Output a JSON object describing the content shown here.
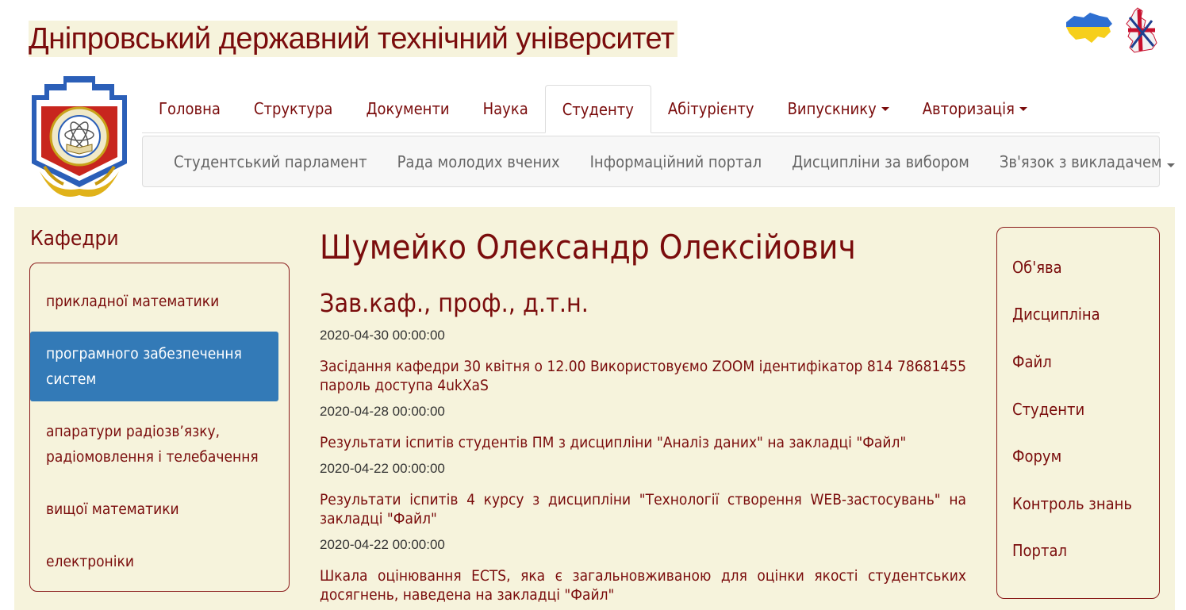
{
  "site": {
    "title": "Дніпровський державний технічний університет"
  },
  "languages": [
    {
      "icon": "ukraine-flag-icon"
    },
    {
      "icon": "uk-flag-icon"
    }
  ],
  "main_nav": [
    {
      "label": "Головна"
    },
    {
      "label": "Структура"
    },
    {
      "label": "Документи"
    },
    {
      "label": "Наука"
    },
    {
      "label": "Студенту",
      "active": true
    },
    {
      "label": "Абітурієнту"
    },
    {
      "label": "Випускнику",
      "dropdown": true
    },
    {
      "label": "Авторизація",
      "dropdown": true
    }
  ],
  "sub_nav": [
    {
      "label": "Студентський парламент"
    },
    {
      "label": "Рада молодих вчених"
    },
    {
      "label": "Інформаційний портал"
    },
    {
      "label": "Дисципліни за вибором"
    },
    {
      "label": "Зв'язок з викладачем",
      "dropdown": true
    }
  ],
  "departments": {
    "heading": "Кафедри",
    "items": [
      {
        "label": "прикладної математики"
      },
      {
        "label": "програмного забезпечення систем",
        "active": true
      },
      {
        "label": "апаратури радіозв’язку, радіомовлення і телебачення"
      },
      {
        "label": "вищої математики"
      },
      {
        "label": "електроніки"
      }
    ]
  },
  "person": {
    "name": "Шумейко Олександр Олексійович",
    "title": "Зав.каф., проф., д.т.н."
  },
  "news": [
    {
      "date": "2020-04-30 00:00:00",
      "text": "Засідання кафедри 30 квітня о 12.00 Використовуємо ZOOM ідентифікатор 814 78681455 пароль доступа 4ukXaS"
    },
    {
      "date": "2020-04-28 00:00:00",
      "text": "Результати іспитів студентів ПМ з дисципліни \"Аналіз даних\" на закладці \"Файл\""
    },
    {
      "date": "2020-04-22 00:00:00",
      "text": "Результати іспитів 4 курсу з дисципліни \"Технології створення WEB-застосувань\" на закладці \"Файл\""
    },
    {
      "date": "2020-04-22 00:00:00",
      "text": "Шкала оцінювання ECTS, яка є загальновживаною для оцінки якості студентських досягнень, наведена на закладці \"Файл\""
    }
  ],
  "side_menu": [
    {
      "label": "Об'ява"
    },
    {
      "label": "Дисципліна"
    },
    {
      "label": "Файл"
    },
    {
      "label": "Студенти"
    },
    {
      "label": "Форум"
    },
    {
      "label": "Контроль знань"
    },
    {
      "label": "Портал"
    }
  ],
  "colors": {
    "brand": "#7a0c0c",
    "band": "#f6f3dc",
    "active": "#337ab7"
  }
}
